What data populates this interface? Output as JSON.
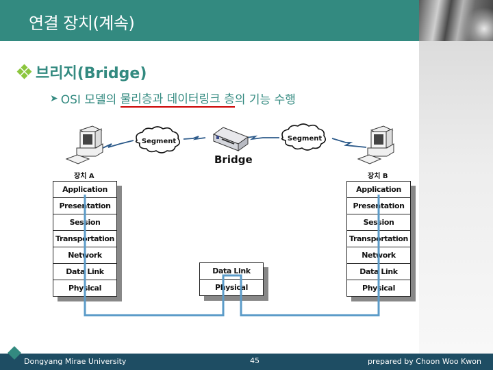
{
  "slide": {
    "title": "연결 장치(계속)",
    "heading": "브리지(Bridge)",
    "subline": {
      "prefix": "OSI 모델의 ",
      "highlight": "물리층과 데이터링크 층",
      "suffix": "의 기능 수행"
    }
  },
  "diagram": {
    "device_a_label": "장치 A",
    "device_b_label": "장치 B",
    "bridge_label": "Bridge",
    "segment_left": "Segment",
    "segment_right": "Segment",
    "stack_a": [
      "Application",
      "Presentation",
      "Session",
      "Transportation",
      "Network",
      "Data Link",
      "Physical"
    ],
    "stack_bridge": [
      "Data Link",
      "Physical"
    ],
    "stack_b": [
      "Application",
      "Presentation",
      "Session",
      "Transportation",
      "Network",
      "Data Link",
      "Physical"
    ],
    "link_color": "#5b9bc8"
  },
  "footer": {
    "institution": "Dongyang Mirae University",
    "page_number": "45",
    "author": "prepared by Choon Woo Kwon"
  },
  "colors": {
    "brand_teal": "#338a80",
    "footer_navy": "#1e4d63",
    "highlight_underline": "#cc0000"
  }
}
